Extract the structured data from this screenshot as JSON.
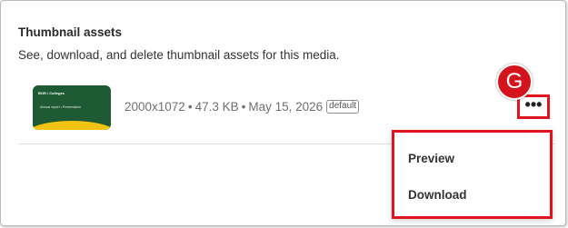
{
  "section": {
    "title": "Thumbnail assets",
    "description": "See, download, and delete thumbnail assets for this media."
  },
  "asset": {
    "thumbnail": {
      "brand_text": "BOR / Colleges",
      "headline_text": "Annual report • Presentation"
    },
    "dimensions": "2000x1072",
    "size": "47.3 KB",
    "date": "May 15, 2026",
    "separator": "•",
    "badge": "default"
  },
  "more_button": {
    "icon": "more-horizontal-icon",
    "glyph": "•••"
  },
  "step_marker": {
    "label": "G",
    "color": "#d4141c"
  },
  "menu": {
    "items": [
      {
        "label": "Preview"
      },
      {
        "label": "Download"
      }
    ]
  },
  "colors": {
    "highlight": "#e0141e",
    "thumbnail_green": "#1e5a33",
    "thumbnail_yellow": "#f2c313"
  }
}
